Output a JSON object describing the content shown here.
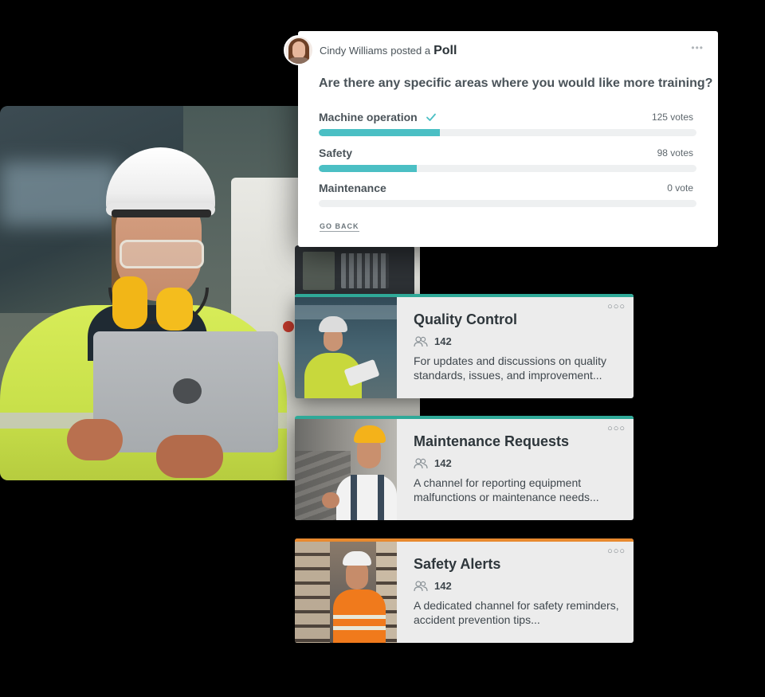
{
  "poll": {
    "author": "Cindy Williams",
    "posted_text": "posted a",
    "type_label": "Poll",
    "more_label": "•••",
    "question": "Are there any specific areas where you would like more training?",
    "options": [
      {
        "label": "Machine operation",
        "votes_text": "125 votes",
        "votes": 125,
        "selected": true,
        "fill_percent": 32
      },
      {
        "label": "Safety",
        "votes_text": "98 votes",
        "votes": 98,
        "selected": false,
        "fill_percent": 26
      },
      {
        "label": "Maintenance",
        "votes_text": "0 vote",
        "votes": 0,
        "selected": false,
        "fill_percent": 0
      }
    ],
    "bar_color": "#4bbfc4",
    "go_back_label": "GO BACK"
  },
  "channels": [
    {
      "title": "Quality Control",
      "members": "142",
      "description": "For updates and discussions on quality standards, issues, and improvement...",
      "accent": "#2fa998",
      "more_label": "○○○"
    },
    {
      "title": "Maintenance Requests",
      "members": "142",
      "description": "A channel for reporting equipment malfunctions or maintenance needs...",
      "accent": "#2fa998",
      "more_label": "○○○"
    },
    {
      "title": "Safety Alerts",
      "members": "142",
      "description": "A dedicated channel for safety reminders, accident prevention tips...",
      "accent": "#e8892e",
      "more_label": "○○○"
    }
  ]
}
